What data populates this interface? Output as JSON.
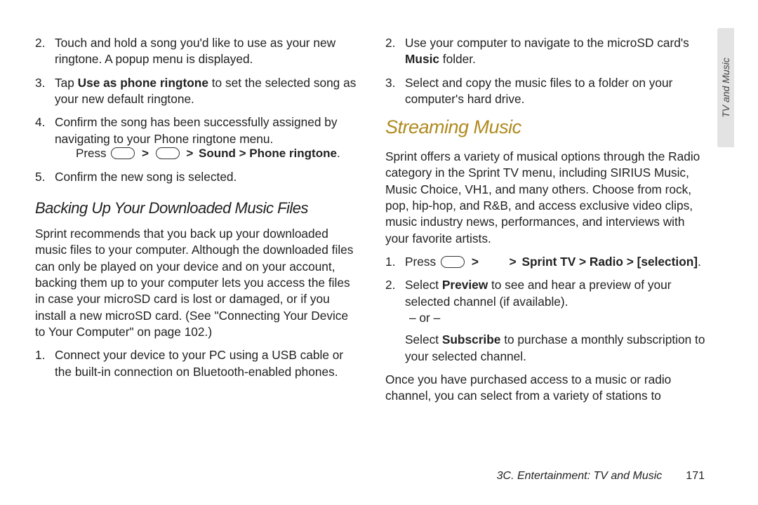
{
  "left": {
    "step2": "Touch and hold a song you'd like to use as your new ringtone. A popup menu is displayed.",
    "step3_pre": "Tap ",
    "step3_bold": "Use as phone ringtone",
    "step3_post": " to set the selected song as your new default ringtone.",
    "step4": "Confirm the song has been successfully assigned by navigating to your Phone ringtone menu.",
    "press_label": "Press",
    "press_path_bold": "Sound > Phone ringtone",
    "press_dot": ".",
    "step5": "Confirm the new song is selected.",
    "subhead": "Backing Up Your Downloaded Music Files",
    "para": "Sprint recommends that you back up your downloaded music files to your computer. Although the downloaded files can only be played on your device and on your account, backing them up to your computer lets you access the files in case your microSD card is lost or damaged, or if you install a new microSD card. (See \"Connecting Your Device to Your Computer\" on page 102.)",
    "b_step1": "Connect your device to your PC using a USB cable or the built-in connection on Bluetooth-enabled phones."
  },
  "right": {
    "r_step2_pre": "Use your computer to navigate to the microSD card's ",
    "r_step2_bold": "Music",
    "r_step2_post": " folder.",
    "r_step3": "Select and copy the music files to a folder on your computer's hard drive.",
    "head": "Streaming Music",
    "para": "Sprint offers a variety of musical options through the Radio category in the Sprint TV menu, including SIRIUS Music, Music Choice, VH1, and many others. Choose from rock, pop, hip-hop, and R&B, and access exclusive video clips, music industry news, performances, and interviews with your favorite artists.",
    "s_step1_pre": "Press",
    "s_step1_bold": "Sprint TV > Radio > [selection]",
    "s_step1_dot": ".",
    "s_step2_pre": "Select ",
    "s_step2_bold": "Preview",
    "s_step2_post": " to see and hear a preview of your selected channel (if available).",
    "or": "– or –",
    "sub_pre": "Select ",
    "sub_bold": "Subscribe",
    "sub_post": " to purchase a monthly subscription to your selected channel.",
    "closing": "Once you have purchased access to a music or radio channel, you can select from a variety of stations to"
  },
  "tab": "TV and Music",
  "footer_section": "3C. Entertainment: TV and Music",
  "footer_page": "171",
  "nums": {
    "n1": "1.",
    "n2": "2.",
    "n3": "3.",
    "n4": "4.",
    "n5": "5."
  },
  "gt": ">"
}
